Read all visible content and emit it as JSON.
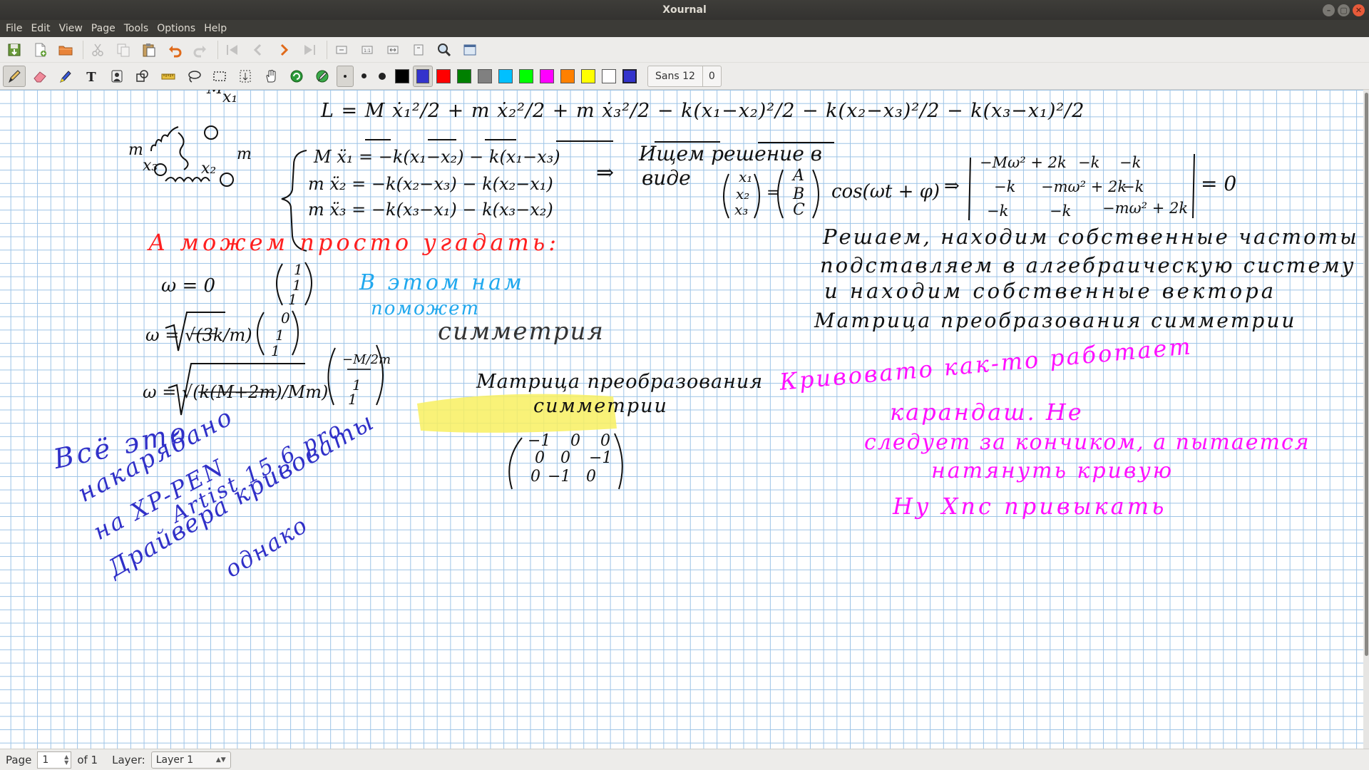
{
  "window": {
    "title": "Xournal",
    "buttons": [
      "–",
      "▢",
      "✕"
    ]
  },
  "menubar": [
    "File",
    "Edit",
    "View",
    "Page",
    "Tools",
    "Options",
    "Help"
  ],
  "toolbar_main": [
    "save-icon",
    "new-page-icon",
    "open-icon",
    "cut-icon",
    "copy-icon",
    "paste-icon",
    "undo-icon",
    "redo-icon",
    "first-page-icon",
    "prev-page-icon",
    "next-page-icon",
    "last-page-icon",
    "zoom-out-icon",
    "zoom-100-icon",
    "zoom-width-icon",
    "zoom-in-icon",
    "zoom-icon",
    "fullscreen-icon"
  ],
  "toolbar_tools": {
    "tools": [
      "pen-icon",
      "eraser-icon",
      "highlighter-icon",
      "text-icon",
      "image-icon",
      "shape-icon",
      "ruler-icon",
      "lasso-icon",
      "rect-select-icon",
      "vspace-icon",
      "hand-icon",
      "default-tool-icon",
      "pen-default-icon"
    ],
    "thickness": [
      "fine",
      "medium",
      "thick"
    ],
    "colors": [
      {
        "name": "black",
        "hex": "#000000"
      },
      {
        "name": "blue",
        "hex": "#3333cc"
      },
      {
        "name": "red",
        "hex": "#ff0000"
      },
      {
        "name": "green",
        "hex": "#008000"
      },
      {
        "name": "gray",
        "hex": "#808080"
      },
      {
        "name": "light-blue",
        "hex": "#00c0ff"
      },
      {
        "name": "light-green",
        "hex": "#00ff00"
      },
      {
        "name": "magenta",
        "hex": "#ff00ff"
      },
      {
        "name": "orange",
        "hex": "#ff8000"
      },
      {
        "name": "yellow",
        "hex": "#ffff00"
      },
      {
        "name": "white",
        "hex": "#ffffff"
      },
      {
        "name": "current",
        "hex": "#3333cc"
      }
    ],
    "font_name": "Sans 12",
    "font_extra": "0"
  },
  "canvas": {
    "red_text": "А можем просто угадать:",
    "cyan_text_1": "В этом нам",
    "cyan_text_2": "поможет",
    "symmetry_word": "симметрия",
    "right_black_1": "Решаем, находим собственные частоты",
    "right_black_2": "подставляем в алгебраическую систему",
    "right_black_3": "и находим собственные вектора",
    "right_black_4": "Матрица преобразования симметрии",
    "mid_black_1": "Матрица преобразования",
    "mid_black_2": "симметрии",
    "blue_note_1": "Всё это",
    "blue_note_2": "накарябано",
    "blue_note_3": "на XP-PEN",
    "blue_note_4": "Artist 15.6 pro",
    "blue_note_5": "Драйвера кривоваты",
    "blue_note_6": "однако",
    "magenta_1": "Кривовато как-то работает",
    "magenta_2": "карандаш. Не",
    "magenta_3": "следует за кончиком, а пытается",
    "magenta_4": "натянуть кривую",
    "magenta_5": "Ну Xпс привыкать",
    "search_label": "Ищем решение в",
    "search_label_2": "виде",
    "eq_L": "L = M ẋ₁²/2 + m ẋ₂²/2 + m ẋ₃²/2 − k(x₁−x₂)²/2 − k(x₂−x₃)²/2 − k(x₃−x₁)²/2",
    "sys_1": "M ẍ₁ = −k(x₁−x₂) − k(x₁−x₃)",
    "sys_2": "m ẍ₂ = −k(x₂−x₃) − k(x₂−x₁)",
    "sys_3": "m ẍ₃ = −k(x₃−x₁) − k(x₃−x₂)",
    "implies": "⇒",
    "vec_x": [
      "x₁",
      "x₂",
      "x₃"
    ],
    "vec_abc": [
      "A",
      "B",
      "C"
    ],
    "cos_term": "cos(ωt + φ)",
    "det_rows": [
      [
        "−Mω² + 2k",
        "−k",
        "−k"
      ],
      [
        "−k",
        "−mω² + 2k",
        "−k"
      ],
      [
        "−k",
        "−k",
        "−mω² + 2k"
      ]
    ],
    "det_zero": "= 0",
    "omega_0": "ω = 0",
    "omega_1": "ω = √(3k/m)",
    "omega_2": "ω = √(k(M+2m)/Mm)",
    "vec_1": [
      "1",
      "1",
      "1"
    ],
    "vec_2": [
      "0",
      "1",
      "1"
    ],
    "vec_3": [
      "−M/2m",
      "1",
      "1"
    ],
    "sym_matrix": [
      [
        "−1",
        "0",
        "0"
      ],
      [
        "0",
        "0",
        "−1"
      ],
      [
        "0",
        "−1",
        "0"
      ]
    ],
    "diagram_M": "M",
    "diagram_x1": "x₁",
    "diagram_m_left": "m",
    "diagram_m_right": "m",
    "diagram_x3": "x₃",
    "diagram_x2": "x₂",
    "ink_colors": {
      "black": "#111111",
      "red": "#ff2020",
      "cyan": "#20a8ee",
      "blue": "#3030c8",
      "magenta": "#ff10ff",
      "highlight": "#f8f060"
    }
  },
  "statusbar": {
    "page_label": "Page",
    "page_value": "1",
    "of_label": "of 1",
    "layer_label": "Layer:",
    "layer_value": "Layer 1"
  }
}
